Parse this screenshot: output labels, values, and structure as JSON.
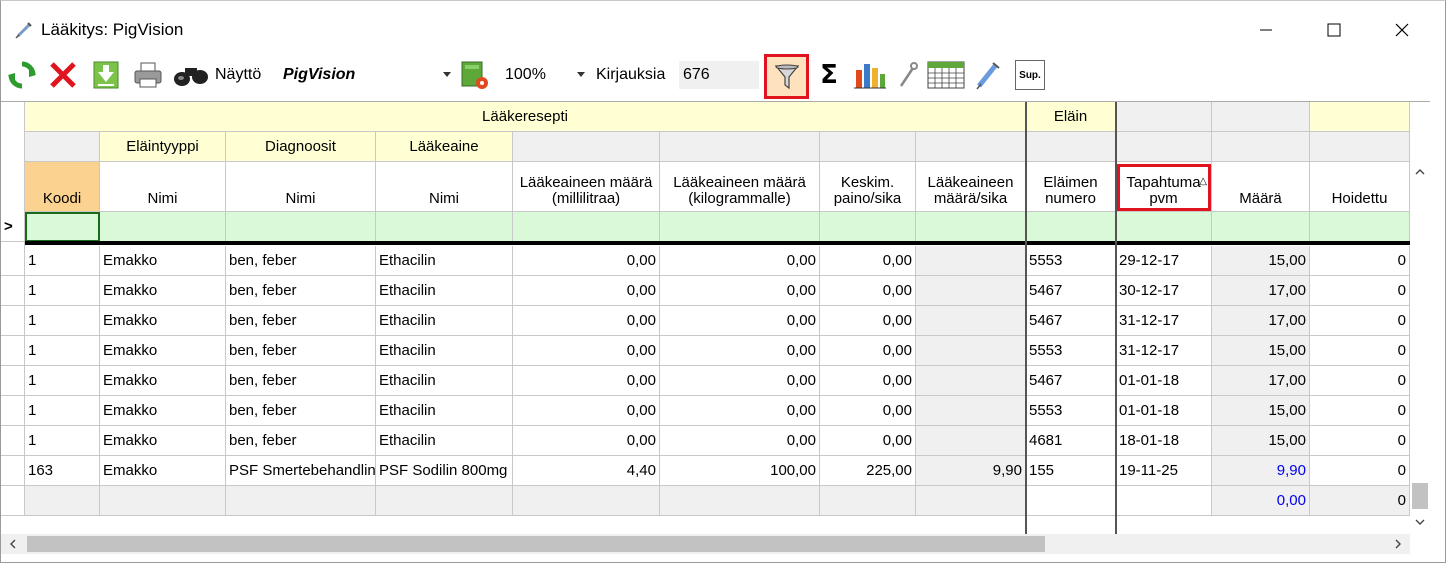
{
  "window": {
    "title": "Lääkitys: PigVision",
    "minimize_glyph": "—",
    "maximize_glyph": "☐",
    "close_glyph": "✕"
  },
  "toolbar": {
    "view_label": "Näyttö",
    "view_value": "PigVision",
    "zoom_value": "100%",
    "records_label": "Kirjauksia",
    "records_count": "676",
    "sigma": "Σ",
    "sup_label": "Sup."
  },
  "grid": {
    "group_headers": {
      "prescription": "Lääkeresepti",
      "animal": "Eläin"
    },
    "sub_headers": {
      "animal_type": "Eläintyyppi",
      "diagnoses": "Diagnoosit",
      "drug": "Lääkeaine"
    },
    "columns": [
      "Koodi",
      "Nimi",
      "Nimi",
      "Nimi",
      "Lääkeaineen määrä (millilitraa)",
      "Lääkeaineen määrä (kilogrammalle)",
      "Keskim. paino/sika",
      "Lääkeaineen määrä/sika",
      "Eläimen numero",
      "Tapahtuma pvm",
      "Määrä",
      "Hoidettu"
    ],
    "new_row_marker": ">",
    "rows": [
      [
        "1",
        "Emakko",
        "ben, feber",
        "Ethacilin",
        "0,00",
        "0,00",
        "0,00",
        "",
        "5553",
        "29-12-17",
        "15,00",
        "0"
      ],
      [
        "1",
        "Emakko",
        "ben, feber",
        "Ethacilin",
        "0,00",
        "0,00",
        "0,00",
        "",
        "5467",
        "30-12-17",
        "17,00",
        "0"
      ],
      [
        "1",
        "Emakko",
        "ben, feber",
        "Ethacilin",
        "0,00",
        "0,00",
        "0,00",
        "",
        "5467",
        "31-12-17",
        "17,00",
        "0"
      ],
      [
        "1",
        "Emakko",
        "ben, feber",
        "Ethacilin",
        "0,00",
        "0,00",
        "0,00",
        "",
        "5553",
        "31-12-17",
        "15,00",
        "0"
      ],
      [
        "1",
        "Emakko",
        "ben, feber",
        "Ethacilin",
        "0,00",
        "0,00",
        "0,00",
        "",
        "5467",
        "01-01-18",
        "17,00",
        "0"
      ],
      [
        "1",
        "Emakko",
        "ben, feber",
        "Ethacilin",
        "0,00",
        "0,00",
        "0,00",
        "",
        "5553",
        "01-01-18",
        "15,00",
        "0"
      ],
      [
        "1",
        "Emakko",
        "ben, feber",
        "Ethacilin",
        "0,00",
        "0,00",
        "0,00",
        "",
        "4681",
        "18-01-18",
        "15,00",
        "0"
      ],
      [
        "163",
        "Emakko",
        "PSF Smertebehandling",
        "PSF Sodilin 800mg",
        "4,40",
        "100,00",
        "225,00",
        "9,90",
        "155",
        "19-11-25",
        "9,90",
        "0"
      ]
    ],
    "total_row": [
      "",
      "",
      "",
      "",
      "",
      "",
      "",
      "",
      "",
      "",
      "0,00",
      "0"
    ]
  },
  "colors": {
    "accent_red": "#e0141e",
    "header_yellow": "#ffffd3",
    "new_row_green": "#d9f9d9",
    "koodi_orange": "#fbd28f",
    "link_blue": "#0000ee"
  }
}
